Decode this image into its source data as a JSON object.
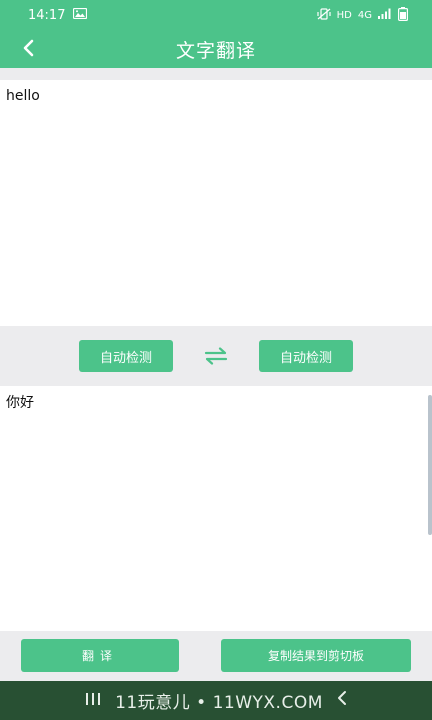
{
  "status_bar": {
    "time": "14:17",
    "indicators": [
      "mute-vibrate-icon",
      "HD",
      "4G",
      "signal-icon",
      "battery-icon"
    ],
    "hd_label": "HD",
    "net_label": "4G"
  },
  "header": {
    "title": "文字翻译",
    "back_icon": "chevron-left-icon"
  },
  "source": {
    "text": "hello"
  },
  "languages": {
    "source_label": "自动检测",
    "target_label": "自动检测",
    "swap_icon": "swap-arrows-icon"
  },
  "result": {
    "text": "你好"
  },
  "actions": {
    "translate_label": "翻译",
    "copy_label": "复制结果到剪切板"
  },
  "nav_bar": {
    "watermark": "11玩意儿 • 11WYX.COM"
  },
  "colors": {
    "accent": "#4cc38a",
    "nav_bar": "#285033",
    "background": "#ececee"
  }
}
